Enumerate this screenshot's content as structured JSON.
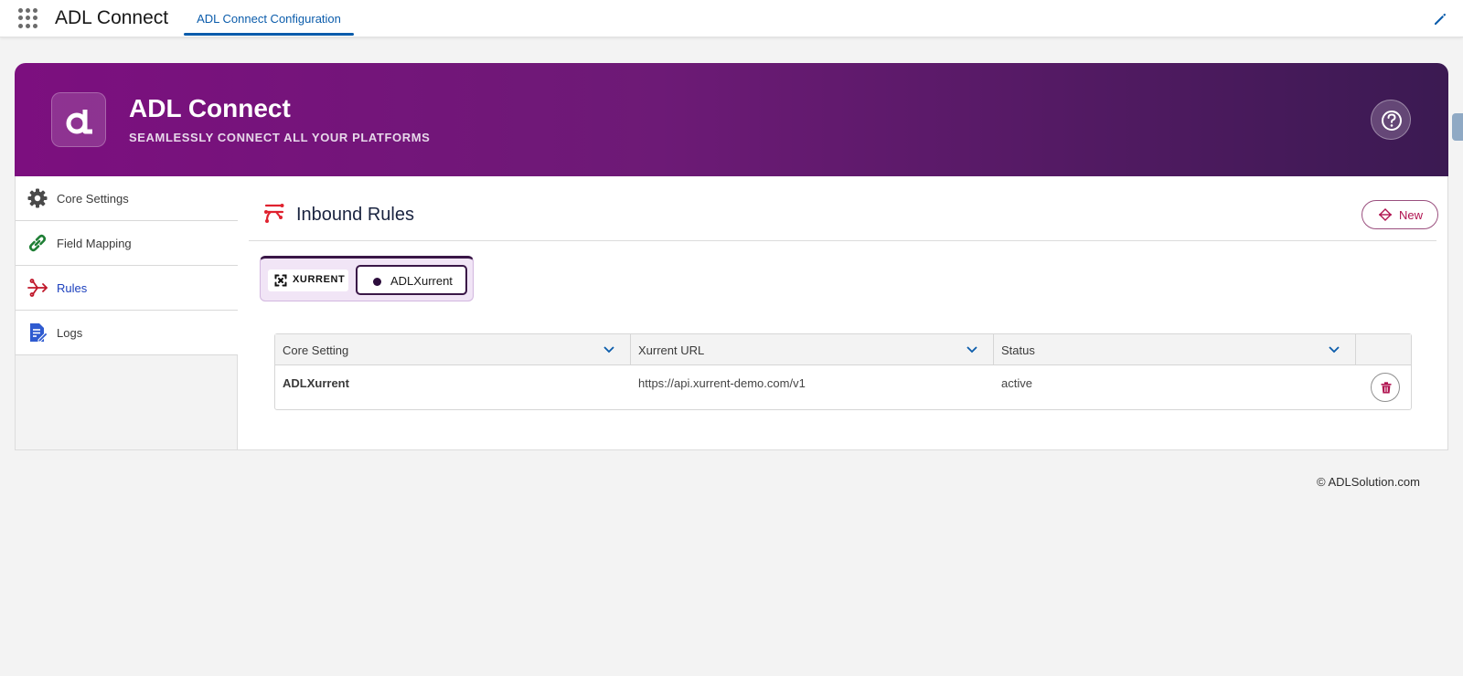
{
  "appbar": {
    "app_name": "ADL Connect",
    "nav_tab": "ADL Connect Configuration"
  },
  "banner": {
    "title": "ADL Connect",
    "subtitle": "SEAMLESSLY CONNECT ALL YOUR PLATFORMS",
    "logo_glyph": "a"
  },
  "sidebar": {
    "items": [
      {
        "label": "Core Settings",
        "icon": "gear-icon",
        "active": false
      },
      {
        "label": "Field Mapping",
        "icon": "link-icon",
        "active": false
      },
      {
        "label": "Rules",
        "icon": "rules-icon",
        "active": true
      },
      {
        "label": "Logs",
        "icon": "logs-icon",
        "active": false
      }
    ]
  },
  "main": {
    "section_title": "Inbound Rules",
    "new_label": "New",
    "brand_label": "XURRENT",
    "active_tab": "ADLXurrent"
  },
  "table": {
    "columns": [
      "Core Setting",
      "Xurrent URL",
      "Status"
    ],
    "rows": [
      {
        "core_setting": "ADLXurrent",
        "url": "https://api.xurrent-demo.com/v1",
        "status": "active"
      }
    ]
  },
  "footer": {
    "copyright": "© ADLSolution.com"
  },
  "colors": {
    "brand_purple": "#7c0f7f",
    "brand_dark": "#3b1a52",
    "accent_blue": "#0b5cab",
    "new_button_text": "#b0124f"
  }
}
